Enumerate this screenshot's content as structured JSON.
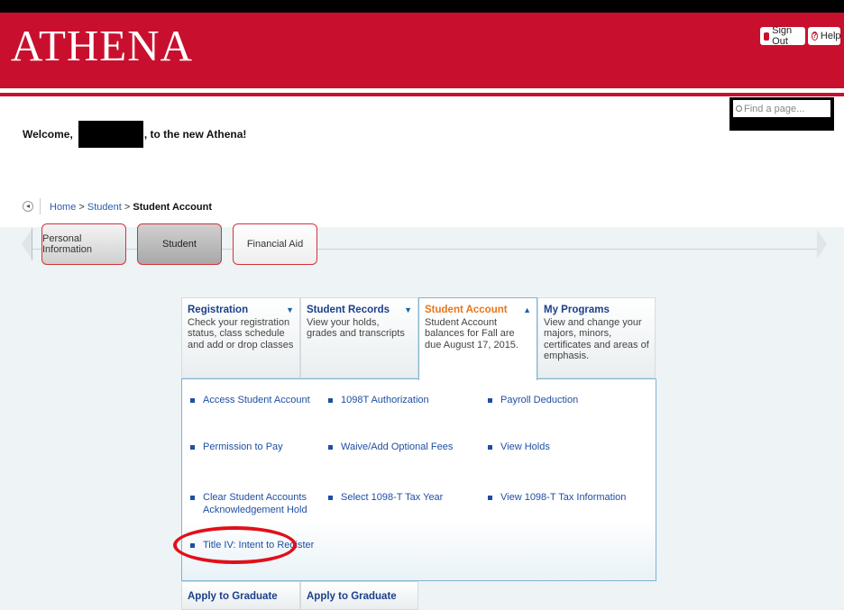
{
  "header": {
    "logo": "ATHENA",
    "sign_out": "Sign Out",
    "help": "Help"
  },
  "search": {
    "placeholder": "Find a page..."
  },
  "welcome": {
    "prefix": "Welcome,",
    "suffix": ", to the new Athena!"
  },
  "breadcrumb": {
    "home": "Home",
    "sep": ">",
    "student": "Student",
    "current": "Student Account"
  },
  "category_tabs": [
    {
      "label": "Personal Information"
    },
    {
      "label": "Student"
    },
    {
      "label": "Financial Aid"
    }
  ],
  "tabs": [
    {
      "title": "Registration",
      "desc": "Check your registration status, class schedule and add or drop classes",
      "indicator": "▼"
    },
    {
      "title": "Student Records",
      "desc": "View your holds, grades and transcripts",
      "indicator": "▼"
    },
    {
      "title": "Student Account",
      "desc": "Student Account balances for Fall are due August 17, 2015.",
      "indicator": "▲"
    },
    {
      "title": "My Programs",
      "desc": "View and change your majors, minors, certificates and areas of emphasis.",
      "indicator": ""
    }
  ],
  "links": [
    "Access Student Account",
    "1098T Authorization",
    "Payroll Deduction",
    "Permission to Pay",
    "Waive/Add Optional Fees",
    "View Holds",
    "Clear Student Accounts Acknowledgement Hold",
    "Select 1098-T Tax Year",
    "View 1098-T Tax Information",
    "Title IV: Intent to Register"
  ],
  "bottom_tabs": [
    {
      "title": "Apply to Graduate"
    },
    {
      "title": "Apply to Graduate"
    }
  ],
  "colors": {
    "brand_red": "#c8102e",
    "link_blue": "#1f4fa3",
    "active_orange": "#e8761a",
    "highlight_ring": "#e0101a"
  }
}
